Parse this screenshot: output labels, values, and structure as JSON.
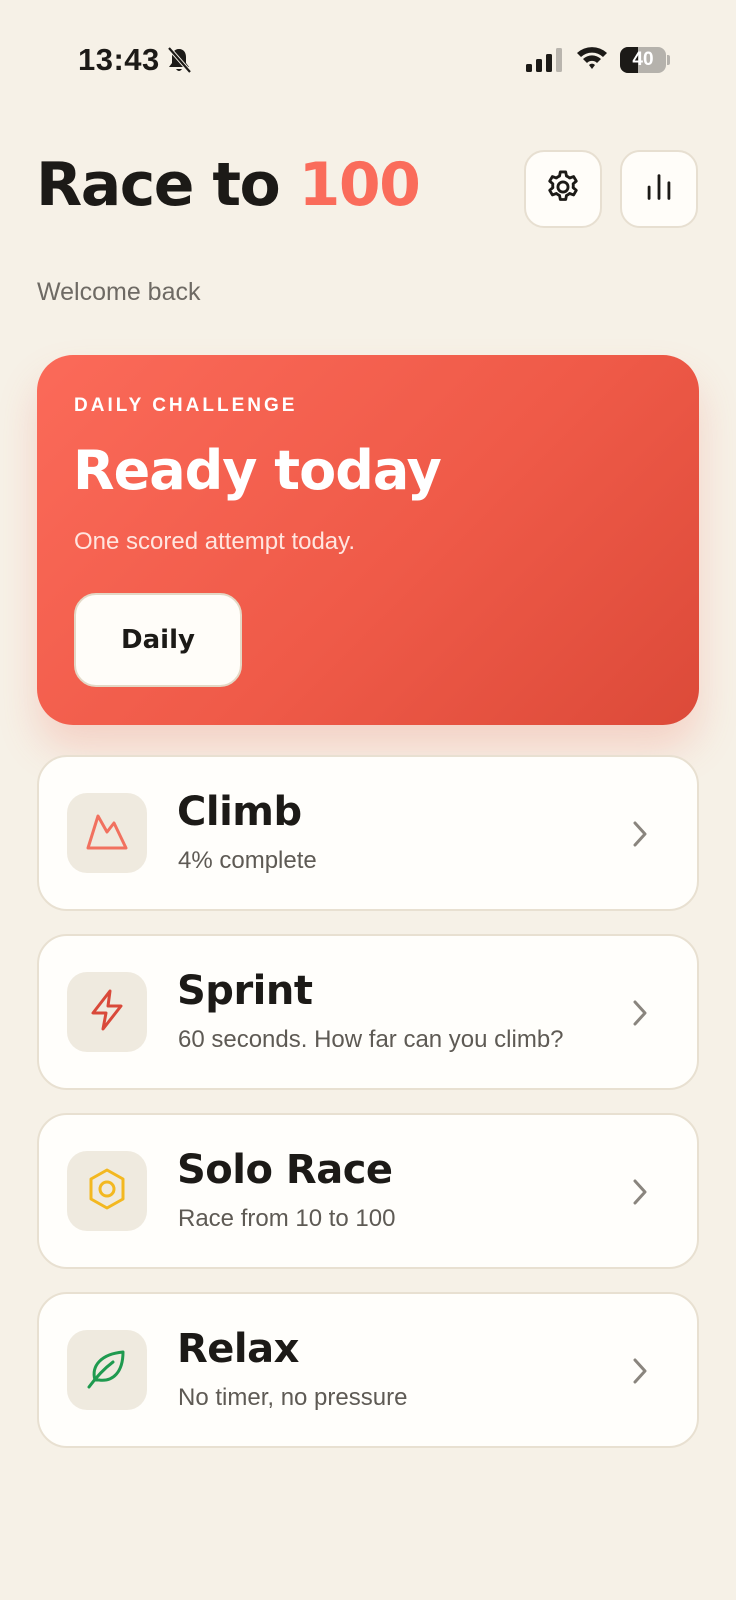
{
  "status_bar": {
    "time": "13:43",
    "battery_percent": "40",
    "battery_level": 0.4
  },
  "header": {
    "title_part1": "Race to ",
    "title_part2": "100",
    "welcome": "Welcome back",
    "settings_icon": "gear-icon",
    "stats_icon": "bar-chart-icon"
  },
  "daily": {
    "label": "DAILY CHALLENGE",
    "title": "Ready today",
    "subtitle": "One scored attempt today.",
    "button_label": "Daily"
  },
  "modes": [
    {
      "title": "Climb",
      "subtitle": "4% complete",
      "icon": "mountain-icon",
      "icon_color": "#f1715f"
    },
    {
      "title": "Sprint",
      "subtitle": "60 seconds. How far can you climb?",
      "icon": "lightning-icon",
      "icon_color": "#d9493a"
    },
    {
      "title": "Solo Race",
      "subtitle": "Race from 10 to 100",
      "icon": "hexagon-icon",
      "icon_color": "#f3b820"
    },
    {
      "title": "Relax",
      "subtitle": "No timer, no pressure",
      "icon": "leaf-icon",
      "icon_color": "#1f9a4f"
    }
  ],
  "colors": {
    "background": "#f6f1e7",
    "accent": "#fa6c5b",
    "text": "#1c1a17"
  }
}
